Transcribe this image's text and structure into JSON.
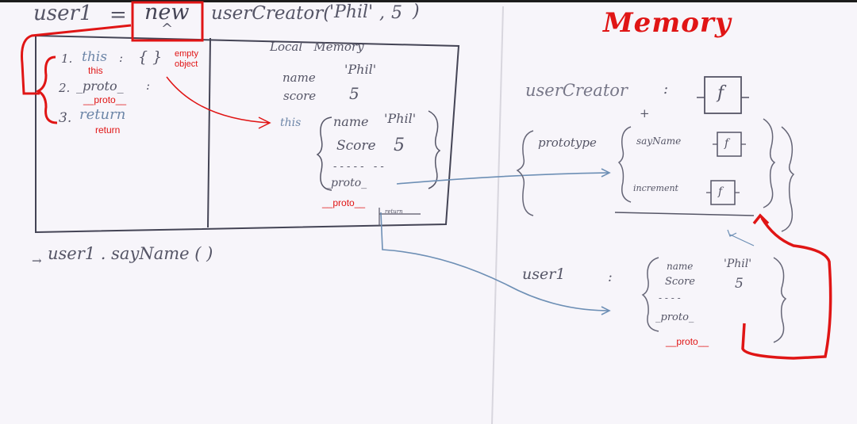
{
  "top_line": {
    "var": "user1",
    "equals": "=",
    "new_kw": "new",
    "caret": "^",
    "call": "userCreator(",
    "arg1": "'Phil'",
    "comma": ",",
    "arg2": "5",
    "close": ")"
  },
  "steps": {
    "s1_num": "1.",
    "s1_text": "this",
    "s1_colon": ":",
    "s1_braces": "{ }",
    "s2_num": "2.",
    "s2_text": "_proto_",
    "s2_colon": ":",
    "s3_num": "3.",
    "s3_text": "return"
  },
  "annotations": {
    "empty_object": "empty\nobject",
    "this": "this",
    "proto_step": "__proto__",
    "return": "return",
    "proto_local": "__proto__",
    "proto_user1": "__proto__"
  },
  "local_memory": {
    "title": "Local   Memory",
    "name_key": "name",
    "name_val": "'Phil'",
    "score_key": "score",
    "score_val": "5",
    "this_key": "this",
    "obj_name_key": "name",
    "obj_name_val": "'Phil'",
    "obj_score_key": "Score",
    "obj_score_val": "5",
    "obj_dashes": "- - - - -   - -",
    "obj_proto": "_proto_",
    "return_label": "return"
  },
  "call_line": {
    "arrow": "→",
    "text": "user1 . sayName ( )"
  },
  "memory": {
    "title": "Memory",
    "usercreator_label": "userCreator",
    "usercreator_colon": ":",
    "f_box": "f",
    "plus": "+",
    "prototype_label": "prototype",
    "saynome_label": "sayName",
    "increment_label": "increment",
    "user1_label": "user1",
    "user1_colon": ":",
    "u_name_key": "name",
    "u_name_val": "'Phil'",
    "u_score_key": "Score",
    "u_score_val": "5",
    "u_dashes": "- - - -",
    "u_proto": "_proto_"
  },
  "colors": {
    "ink": "#556677",
    "blue_arrow": "#6d8fb5",
    "red": "#e01515",
    "background": "#f7f5fa"
  }
}
